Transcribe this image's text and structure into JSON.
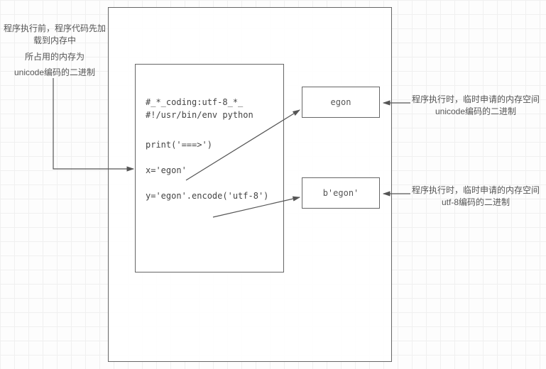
{
  "left_annotation": {
    "line1": "程序执行前，程序代码先加载到内存中",
    "line2": "所占用的内存为",
    "line3": "unicode编码的二进制"
  },
  "code": {
    "l1": "#_*_coding:utf-8_*_",
    "l2": "#!/usr/bin/env python",
    "l3": "",
    "l4": "print('===>')",
    "l5": "",
    "l6": "x='egon'",
    "l7": "",
    "l8": "y='egon'.encode('utf-8')"
  },
  "mem1_value": "egon",
  "mem2_value": "b'egon'",
  "right_annotation_1": {
    "line1": "程序执行时，临时申请的内存空间",
    "line2": "unicode编码的二进制"
  },
  "right_annotation_2": {
    "line1": "程序执行时，临时申请的内存空间",
    "line2": "utf-8编码的二进制"
  }
}
